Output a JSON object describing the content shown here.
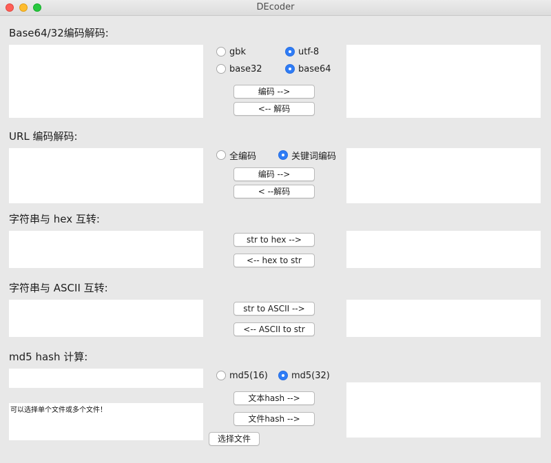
{
  "window": {
    "title": "DEcoder"
  },
  "base64": {
    "heading": "Base64/32编码解码:",
    "radio_gbk": "gbk",
    "radio_utf8": "utf-8",
    "radio_base32": "base32",
    "radio_base64": "base64",
    "selected_charset": "utf-8",
    "selected_mode": "base64",
    "encode_label": "编码 -->",
    "decode_label": "<-- 解码",
    "input_value": "",
    "output_value": ""
  },
  "url": {
    "heading": "URL 编码解码:",
    "radio_full": "全编码",
    "radio_keyword": "关键词编码",
    "selected": "关键词编码",
    "encode_label": "编码 -->",
    "decode_label": "< --解码",
    "input_value": "",
    "output_value": ""
  },
  "hex": {
    "heading": "字符串与 hex 互转:",
    "to_hex_label": "str to hex -->",
    "to_str_label": "<-- hex to str",
    "input_value": "",
    "output_value": ""
  },
  "ascii": {
    "heading": "字符串与 ASCII 互转:",
    "to_ascii_label": "str to ASCII -->",
    "to_str_label": "<-- ASCII to str",
    "input_value": "",
    "output_value": ""
  },
  "md5": {
    "heading": "md5 hash 计算:",
    "radio_16": "md5(16)",
    "radio_32": "md5(32)",
    "selected": "md5(32)",
    "text_hash_label": "文本hash -->",
    "file_hash_label": "文件hash -->",
    "select_file_label": "选择文件",
    "file_list_text": "可以选择单个文件或多个文件！",
    "text_input_value": "",
    "output_value": ""
  },
  "colors": {
    "radio_selected": "#2e7cf6",
    "background": "#e8e8e8"
  }
}
